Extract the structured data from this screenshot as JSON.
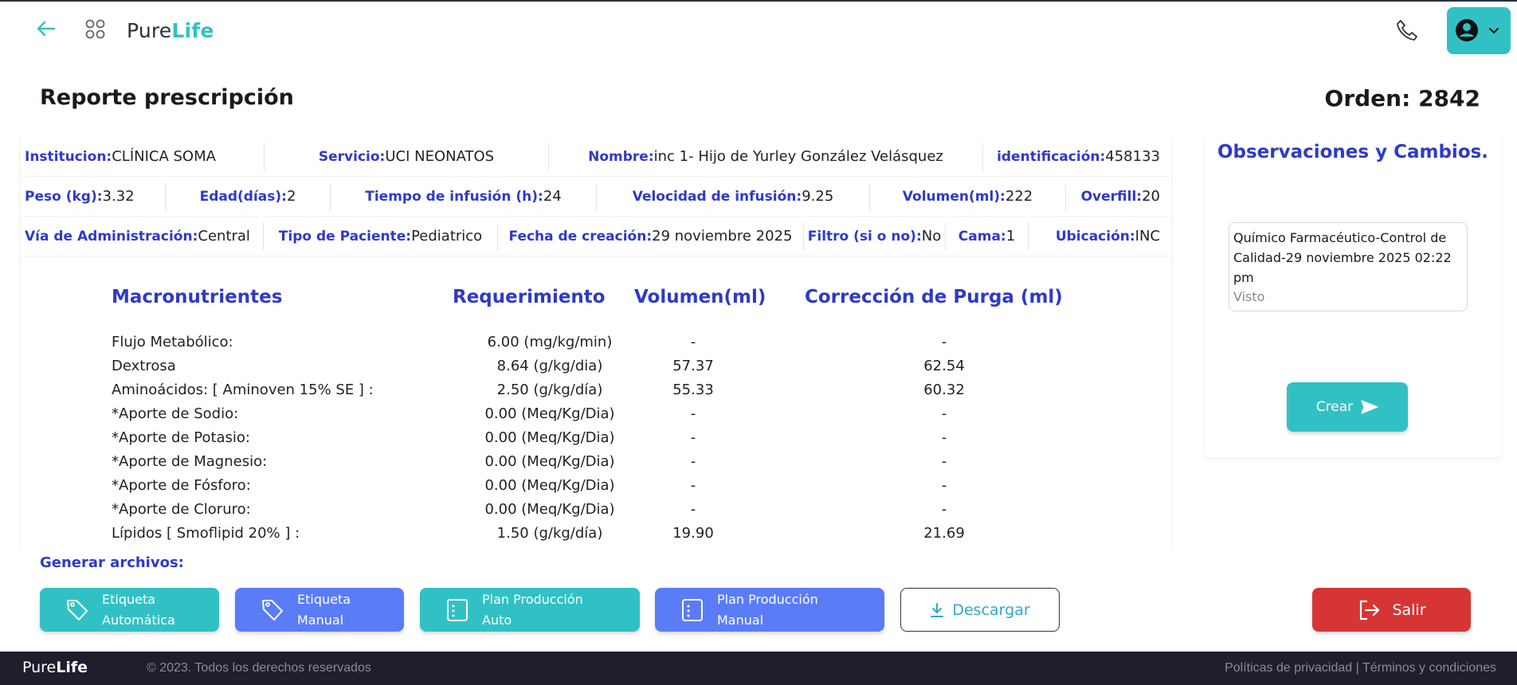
{
  "header": {
    "logo_pure": "Pure",
    "logo_life": "Life"
  },
  "page": {
    "title": "Reporte prescripción",
    "order_label": "Orden:",
    "order_number": "2842"
  },
  "info": {
    "row1": [
      {
        "label": "Institucion:",
        "value": "CLÍNICA SOMA"
      },
      {
        "label": "Servicio:",
        "value": "UCI NEONATOS"
      },
      {
        "label": "Nombre:",
        "value": "inc 1- Hijo de Yurley González Velásquez"
      },
      {
        "label": "identificación:",
        "value": "458133"
      }
    ],
    "row2": [
      {
        "label": "Peso (kg):",
        "value": "3.32"
      },
      {
        "label": "Edad(días):",
        "value": "2"
      },
      {
        "label": "Tiempo de infusión (h):",
        "value": "24"
      },
      {
        "label": "Velocidad de infusión:",
        "value": "9.25"
      },
      {
        "label": "Volumen(ml):",
        "value": "222"
      },
      {
        "label": "Overfill:",
        "value": "20"
      }
    ],
    "row3": [
      {
        "label": "Vía de Administración:",
        "value": "Central"
      },
      {
        "label": "Tipo de Paciente:",
        "value": "Pediatrico"
      },
      {
        "label": "Fecha de creación:",
        "value": "29 noviembre 2025"
      },
      {
        "label": "Filtro (si o no):",
        "value": "No"
      },
      {
        "label": "Cama:",
        "value": "1"
      },
      {
        "label": "Ubicación:",
        "value": "INC"
      }
    ]
  },
  "macros": {
    "headers": [
      "Macronutrientes",
      "Requerimiento",
      "Volumen(ml)",
      "Corrección de Purga (ml)"
    ],
    "rows": [
      [
        "Flujo Metabólico:",
        "6.00 (mg/kg/min)",
        "-",
        "-"
      ],
      [
        "Dextrosa",
        "8.64 (g/kg/dia)",
        "57.37",
        "62.54"
      ],
      [
        "Aminoácidos: [ Aminoven 15% SE ] :",
        "2.50 (g/kg/día)",
        "55.33",
        "60.32"
      ],
      [
        "*Aporte de Sodio:",
        "0.00 (Meq/Kg/Dia)",
        "-",
        "-"
      ],
      [
        "*Aporte de Potasio:",
        "0.00 (Meq/Kg/Dia)",
        "-",
        "-"
      ],
      [
        "*Aporte de Magnesio:",
        "0.00 (Meq/Kg/Dia)",
        "-",
        "-"
      ],
      [
        "*Aporte de Fósforo:",
        "0.00 (Meq/Kg/Dia)",
        "-",
        "-"
      ],
      [
        "*Aporte de Cloruro:",
        "0.00 (Meq/Kg/Dia)",
        "-",
        "-"
      ],
      [
        "Lípidos [ Smoflipid 20% ] :",
        "1.50 (g/kg/día)",
        "19.90",
        "21.69"
      ]
    ]
  },
  "observations": {
    "title": "Observaciones y Cambios.",
    "note_text": "Químico Farmacéutico-Control de Calidad-29 noviembre 2025 02:22 pm",
    "note_status": "Visto",
    "create_label": "Crear"
  },
  "files": {
    "label": "Generar archivos:",
    "buttons": [
      {
        "label": "Etiqueta\nAutomática",
        "color": "#31c1c5",
        "icon": "tag-icon"
      },
      {
        "label": "Etiqueta\nManual",
        "color": "#5a7cf7",
        "icon": "tag-icon"
      },
      {
        "label": "Plan Producción\nAuto",
        "color": "#31c1c5",
        "icon": "document-icon"
      },
      {
        "label": "Plan Producción\nManual",
        "color": "#5a7cf7",
        "icon": "document-icon"
      }
    ],
    "download_label": "Descargar",
    "exit_label": "Salir"
  },
  "footer": {
    "logo_pure": "Pure",
    "logo_life": "Life",
    "copyright": "© 2023. Todos los derechos reservados",
    "links": "Políticas de privacidad | Términos y condiciones"
  },
  "colors": {
    "accent": "#31c1c5",
    "label_blue": "#2f3ac6",
    "button_blue": "#5a7cf7",
    "danger": "#d73535",
    "footer_bg": "#1e1e2c"
  }
}
